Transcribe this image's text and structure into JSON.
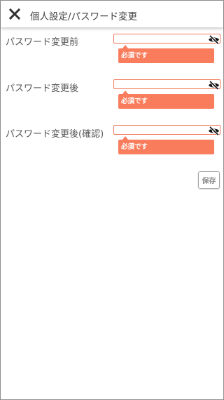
{
  "header": {
    "title": "個人設定/パスワード変更",
    "close_icon": "close-icon"
  },
  "fields": [
    {
      "label": "パスワード変更前",
      "value": "",
      "error": "必須です",
      "visibility_icon": "eye-off-icon"
    },
    {
      "label": "パスワード変更後",
      "value": "",
      "error": "必須です",
      "visibility_icon": "eye-off-icon"
    },
    {
      "label": "パスワード変更後(確認)",
      "value": "",
      "error": "必須です",
      "visibility_icon": "eye-off-icon"
    }
  ],
  "actions": {
    "save_label": "保存"
  },
  "colors": {
    "error": "#f97c5c",
    "input_border": "#f0785a",
    "header_text": "#444444"
  }
}
